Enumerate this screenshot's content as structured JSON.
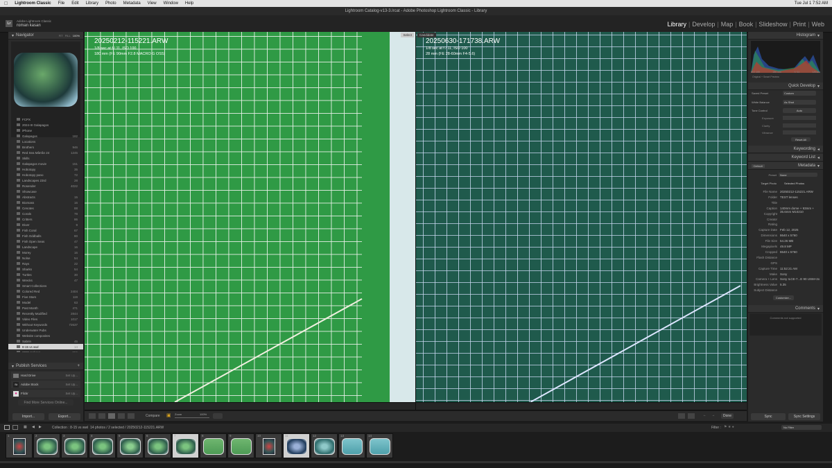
{
  "menubar": {
    "apple": "",
    "items": [
      "Lightroom Classic",
      "File",
      "Edit",
      "Library",
      "Photo",
      "Metadata",
      "View",
      "Window",
      "Help"
    ],
    "clock": "Tue Jul 1  7:52 AM"
  },
  "window_title": "Lightroom Catalog-v13-3.lrcat - Adobe Photoshop Lightroom Classic - Library",
  "identity": {
    "product": "Adobe Lightroom Classic",
    "user": "roman kasan"
  },
  "modules": [
    "Library",
    "Develop",
    "Map",
    "Book",
    "Slideshow",
    "Print",
    "Web"
  ],
  "navigator": {
    "title": "Navigator",
    "zoom": [
      "FIT",
      "FILL",
      "100%"
    ]
  },
  "folders": [
    {
      "label": "FCPX",
      "count": ""
    },
    {
      "label": "2024-III Galapagos",
      "count": ""
    },
    {
      "label": "iPhone",
      "count": ""
    },
    {
      "label": "Galapagos",
      "count": "182"
    },
    {
      "label": "Locations",
      "count": ""
    },
    {
      "label": "Brothers",
      "count": "946"
    },
    {
      "label": "Red Sea Mârrân 24",
      "count": "1245"
    },
    {
      "label": "Skills",
      "count": ""
    },
    {
      "label": "Galapagos movie",
      "count": "151"
    },
    {
      "label": "Hobotopy",
      "count": "35"
    },
    {
      "label": "Hobotopy pano",
      "count": "72"
    },
    {
      "label": "Landscapes 23rd",
      "count": "28"
    },
    {
      "label": "Rosender",
      "count": "4022"
    },
    {
      "label": "Showcase",
      "count": ""
    },
    {
      "label": "Abstracts",
      "count": "15"
    },
    {
      "label": "Biomass",
      "count": "16"
    },
    {
      "label": "Cenotes",
      "count": "88"
    },
    {
      "label": "Corals",
      "count": "78"
    },
    {
      "label": "Critters",
      "count": "86"
    },
    {
      "label": "Diver",
      "count": "9"
    },
    {
      "label": "Fish Coral",
      "count": "67"
    },
    {
      "label": "Fish Oddballs",
      "count": "80"
    },
    {
      "label": "Fish Open Seas",
      "count": "47"
    },
    {
      "label": "Landscape",
      "count": "16"
    },
    {
      "label": "Morey",
      "count": "16"
    },
    {
      "label": "Nolse",
      "count": "54"
    },
    {
      "label": "Rays",
      "count": "22"
    },
    {
      "label": "Sharks",
      "count": "54"
    },
    {
      "label": "Turtles",
      "count": "30"
    },
    {
      "label": "Wrecks",
      "count": "47"
    },
    {
      "label": "Smart Collections",
      "count": ""
    },
    {
      "label": "Colored Red",
      "count": "2404"
    },
    {
      "label": "Five Stars",
      "count": "119"
    },
    {
      "label": "Model",
      "count": "63"
    },
    {
      "label": "Past Month",
      "count": "471"
    },
    {
      "label": "Recently Modified",
      "count": "2844"
    },
    {
      "label": "Video Files",
      "count": "1017"
    },
    {
      "label": "Without Keywords",
      "count": "72637"
    },
    {
      "label": "Underwater Pubs",
      "count": ""
    },
    {
      "label": "Website composites",
      "count": ""
    },
    {
      "label": "Sabrin",
      "count": "45"
    },
    {
      "label": "8-15 vs wwl",
      "count": "14"
    },
    {
      "label": "2025 red sea",
      "count": "556"
    },
    {
      "label": "metchaos",
      "count": "46"
    }
  ],
  "publish": {
    "title": "Publish Services",
    "services": [
      {
        "label": "Hard Drive",
        "action": "Set Up..."
      },
      {
        "label": "Adobe Stock",
        "action": "Set Up..."
      },
      {
        "label": "Flickr",
        "action": "Set Up..."
      }
    ],
    "find_more": "Find More Services Online..."
  },
  "left_buttons": {
    "import": "Import...",
    "export": "Export..."
  },
  "select": {
    "tag": "Select",
    "filename": "20250212-115221.ARW",
    "line1": "1/8 sec at f / 11, ISO 100",
    "line2": "180 mm (FE 90mm F2.8 MACRO G OSS)"
  },
  "candidate": {
    "tag": "Candidate",
    "filename": "20250630-171738.ARW",
    "line1": "1/8 sec at f / 11, ISO 100",
    "line2": "28 mm (FE 28-60mm F4-5.6)"
  },
  "toolbar": {
    "compare": "Compare",
    "zoom": "Zoom",
    "zoom_val": "100%",
    "done": "Done"
  },
  "histogram": {
    "title": "Histogram",
    "readout": [
      "ISO 100",
      "180 mm",
      "f / 11",
      "1/8 sec"
    ],
    "preview": "Original + Smart Preview",
    "colors": {
      "red": "#c0392b",
      "green": "#2e8b57",
      "blue": "#2a4f9e",
      "gray": "#888888"
    }
  },
  "quick_develop": {
    "title": "Quick Develop",
    "saved_preset_label": "Saved Preset",
    "saved_preset_value": "Custom",
    "wb_label": "White Balance",
    "wb_value": "As Shot",
    "tone_label": "Tone Control",
    "auto": "Auto",
    "sliders": [
      "Exposure",
      "Clarity",
      "Vibrance"
    ],
    "reset": "Reset All"
  },
  "keywording": "Keywording",
  "keyword_list": "Keyword List",
  "metadata": {
    "title": "Metadata",
    "preset": "Default",
    "preset_label": "Preset",
    "preset_value": "None",
    "target_label": "Target Photo",
    "target_value": "Selected Photos",
    "fields": [
      {
        "label": "File Name",
        "value": "20250212-115221.ARW"
      },
      {
        "label": "Folder",
        "value": "TEST lenses"
      },
      {
        "label": "Title",
        "value": ""
      },
      {
        "label": "Caption",
        "value": "140mm dome + 93mm + 35.6mm M10210"
      },
      {
        "label": "Copyright",
        "value": ""
      },
      {
        "label": "Creator",
        "value": ""
      },
      {
        "label": "Rating",
        "value": ""
      },
      {
        "label": "Capture Date",
        "value": "Feb 12, 2025"
      },
      {
        "label": "Dimensions",
        "value": "8640 x 5760"
      },
      {
        "label": "File Size",
        "value": "54.26 MB"
      },
      {
        "label": "Megapixels",
        "value": "49.8 MP"
      },
      {
        "label": "Cropped",
        "value": "8640 x 5760"
      },
      {
        "label": "Flash Distance",
        "value": ""
      },
      {
        "label": "GPS",
        "value": ""
      },
      {
        "label": "Capture Time",
        "value": "11:52:21 AM"
      },
      {
        "label": "Make",
        "value": "Sony"
      },
      {
        "label": "Camera + Lens",
        "value": "Sony ILCE-7...E 90 USM+2x"
      },
      {
        "label": "Brightness Value",
        "value": "5.35"
      },
      {
        "label": "Subject Distance",
        "value": ""
      }
    ],
    "customize": "Customize..."
  },
  "comments": {
    "title": "Comments",
    "placeholder": "Comments not supported"
  },
  "sync": {
    "sync": "Sync",
    "sync_settings": "Sync Settings"
  },
  "filmstrip": {
    "collection": "Collection : 8-15 vs wwl",
    "count": "14 photos / 2 selected / 20250212-115221.ARW",
    "filter_label": "Filter :",
    "filter_value": "No Filter",
    "thumbs": [
      "1",
      "2",
      "3",
      "4",
      "5",
      "6",
      "7",
      "8",
      "9",
      "10",
      "11",
      "12",
      "13",
      "14"
    ]
  }
}
